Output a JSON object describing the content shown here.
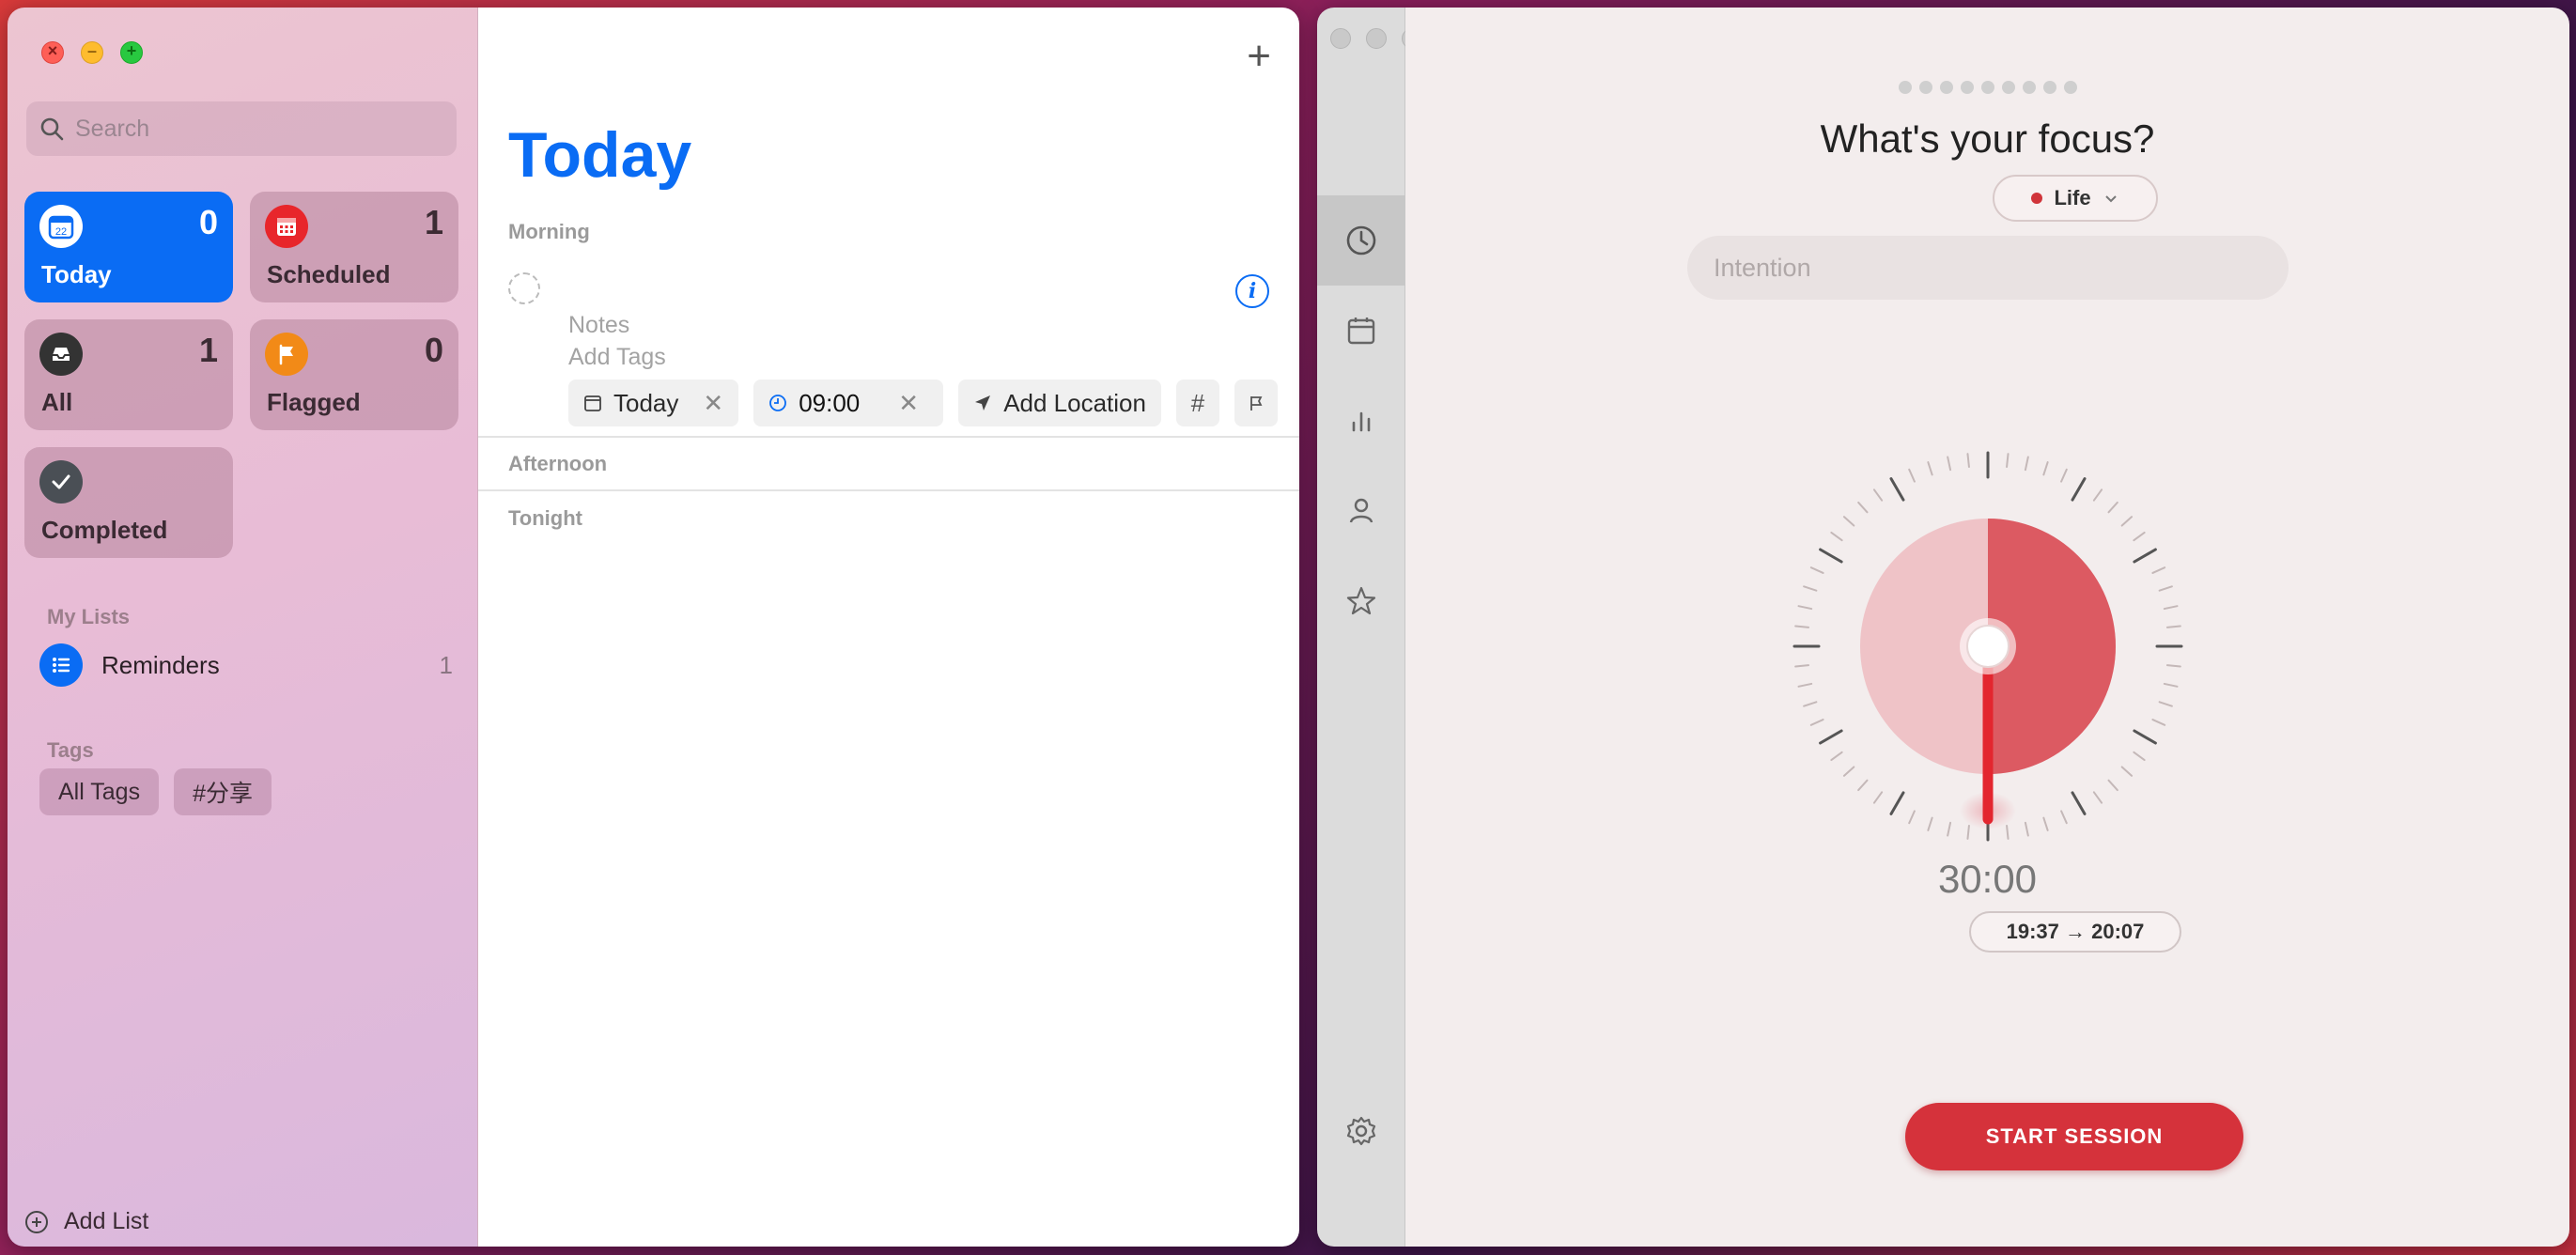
{
  "reminders": {
    "search": {
      "placeholder": "Search"
    },
    "cards": [
      {
        "label": "Today",
        "count": "0",
        "icon": "calendar-today-icon",
        "color": "#0a6cf4",
        "day": "22"
      },
      {
        "label": "Scheduled",
        "count": "1",
        "icon": "calendar-icon",
        "color": "#e8262b"
      },
      {
        "label": "All",
        "count": "1",
        "icon": "tray-icon",
        "color": "#333333"
      },
      {
        "label": "Flagged",
        "count": "0",
        "icon": "flag-icon",
        "color": "#f28a17"
      },
      {
        "label": "Completed",
        "count": "",
        "icon": "checkmark-icon",
        "color": "#4a4f55"
      }
    ],
    "my_lists_heading": "My Lists",
    "lists": [
      {
        "name": "Reminders",
        "count": "1"
      }
    ],
    "tags_heading": "Tags",
    "tags": [
      "All Tags",
      "#分享"
    ],
    "add_list_label": "Add List",
    "main": {
      "title": "Today",
      "groups": {
        "morning": "Morning",
        "afternoon": "Afternoon",
        "tonight": "Tonight"
      },
      "new_item": {
        "notes_placeholder": "Notes",
        "tags_placeholder": "Add Tags",
        "date_chip": "Today",
        "time_value": "09:00",
        "location_chip": "Add Location",
        "tag_chip": "#"
      }
    }
  },
  "focus": {
    "question": "What's your focus?",
    "category": "Life",
    "category_color": "#d0343a",
    "intention_placeholder": "Intention",
    "timer": "30:00",
    "time_range": "19:37 → 20:07",
    "timer_progress_fraction": 0.5,
    "start_label": "START SESSION",
    "nav": [
      "clock-icon",
      "calendar-icon",
      "stats-icon",
      "person-icon",
      "star-icon",
      "gear-icon"
    ]
  }
}
